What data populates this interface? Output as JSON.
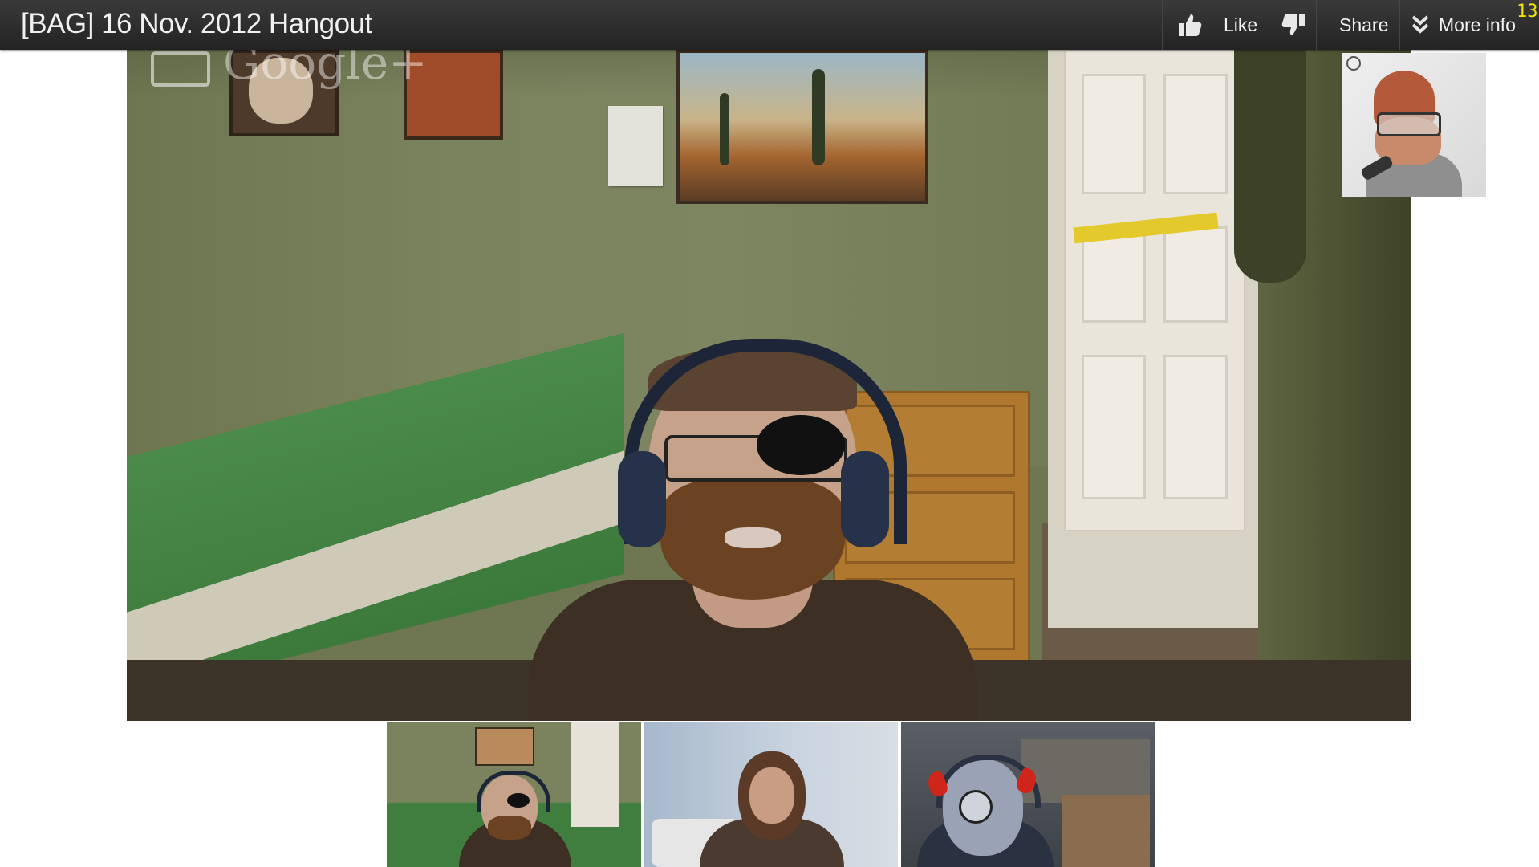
{
  "window": {
    "title": "[BAG] 16 Nov. 2012 Hangout",
    "corner_badge": "13"
  },
  "actions": {
    "like_label": "Like",
    "share_label": "Share",
    "more_info_label": "More info"
  },
  "main_video": {
    "watermark": "Google+"
  },
  "icons": {
    "like": "thumbs-up-icon",
    "dislike": "thumbs-down-icon",
    "more_info": "double-chevron-down-icon"
  },
  "colors": {
    "topbar": "#2b2b2b",
    "badge": "#f2e300",
    "background": "#ffffff"
  }
}
